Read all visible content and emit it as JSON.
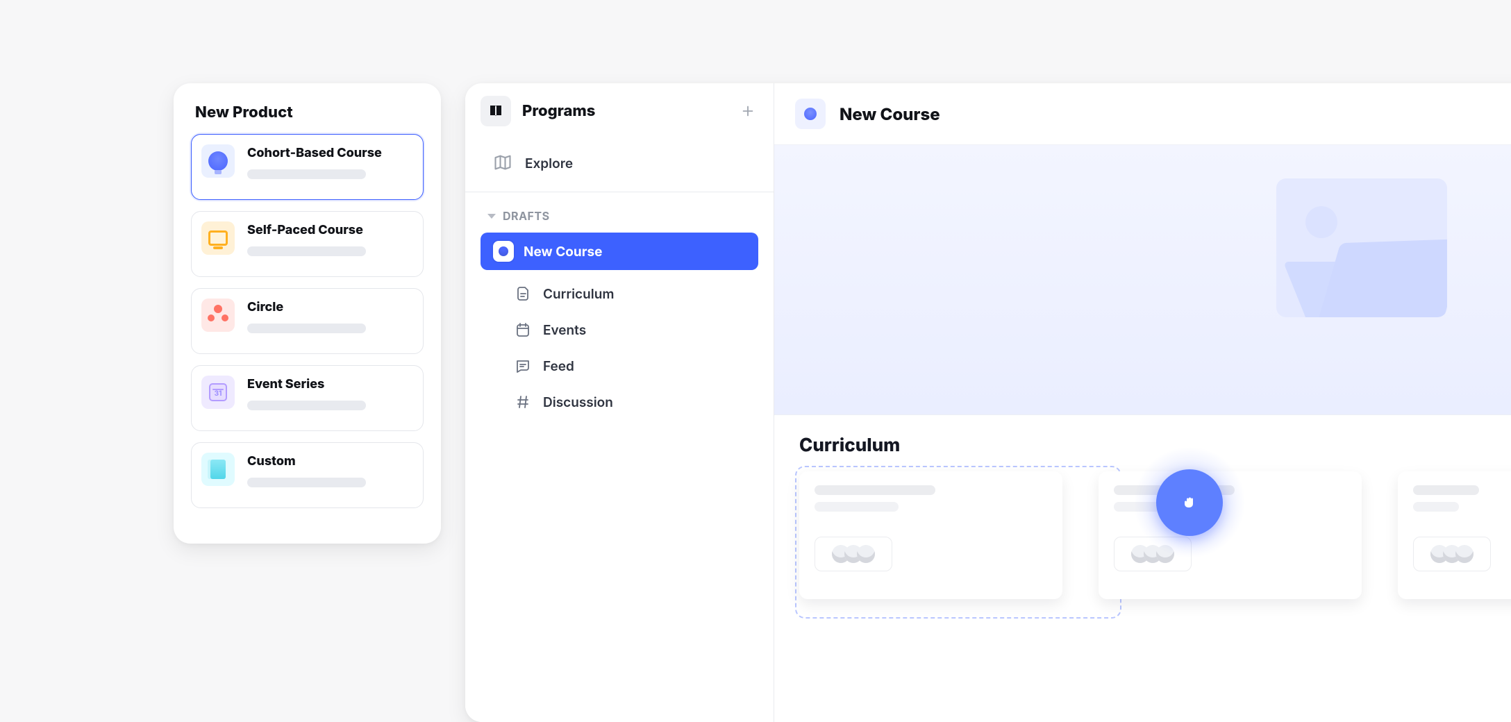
{
  "new_product": {
    "title": "New Product",
    "options": [
      {
        "id": "cohort",
        "label": "Cohort-Based Course",
        "icon": "bulb",
        "chip": "blue",
        "selected": true
      },
      {
        "id": "self_paced",
        "label": "Self-Paced Course",
        "icon": "monitor",
        "chip": "yellow",
        "selected": false
      },
      {
        "id": "circle",
        "label": "Circle",
        "icon": "people",
        "chip": "red",
        "selected": false
      },
      {
        "id": "event_series",
        "label": "Event Series",
        "icon": "calendar",
        "chip": "purple",
        "selected": false,
        "day": "31"
      },
      {
        "id": "custom",
        "label": "Custom",
        "icon": "card",
        "chip": "teal",
        "selected": false
      }
    ]
  },
  "programs": {
    "title": "Programs",
    "explore_label": "Explore",
    "drafts": {
      "header": "DRAFTS",
      "active": {
        "label": "New Course",
        "children": [
          {
            "id": "curriculum",
            "label": "Curriculum",
            "icon": "doc"
          },
          {
            "id": "events",
            "label": "Events",
            "icon": "calendar"
          },
          {
            "id": "feed",
            "label": "Feed",
            "icon": "chat"
          },
          {
            "id": "discussion",
            "label": "Discussion",
            "icon": "hash"
          }
        ]
      }
    }
  },
  "course": {
    "title": "New Course",
    "sections": {
      "curriculum": {
        "title": "Curriculum"
      }
    }
  },
  "colors": {
    "primary": "#3a5cff"
  }
}
